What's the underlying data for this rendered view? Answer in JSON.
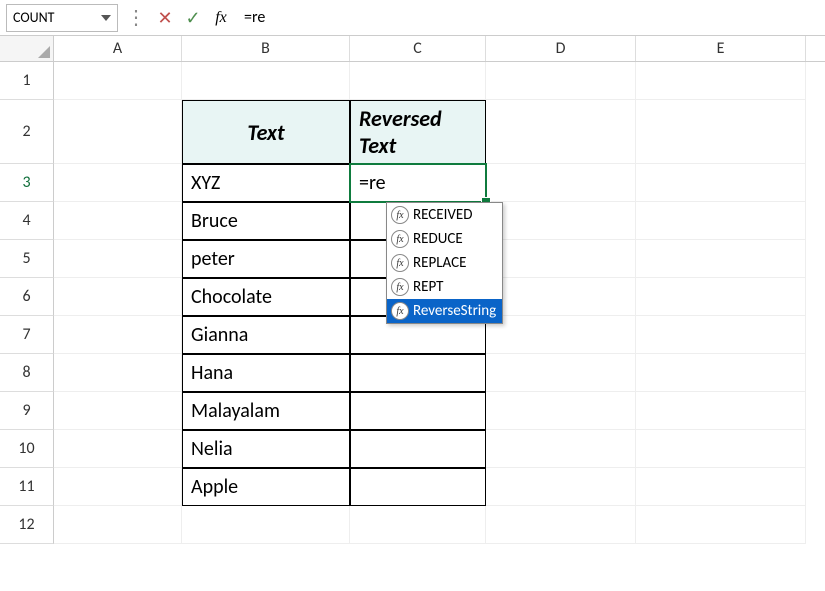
{
  "name_box": "COUNT",
  "formula_bar": "=re",
  "columns": [
    "A",
    "B",
    "C",
    "D",
    "E"
  ],
  "row_numbers": [
    "1",
    "2",
    "3",
    "4",
    "5",
    "6",
    "7",
    "8",
    "9",
    "10",
    "11",
    "12"
  ],
  "headers": {
    "text": "Text",
    "reversed_line1": "Reversed",
    "reversed_line2": "Text"
  },
  "text_values": [
    "XYZ",
    "Bruce",
    "peter",
    "Chocolate",
    "Gianna",
    "Hana",
    "Malayalam",
    "Nelia",
    "Apple"
  ],
  "active_cell_value": "=re",
  "autocomplete": [
    {
      "label": "RECEIVED",
      "selected": false
    },
    {
      "label": "REDUCE",
      "selected": false
    },
    {
      "label": "REPLACE",
      "selected": false
    },
    {
      "label": "REPT",
      "selected": false
    },
    {
      "label": "ReverseString",
      "selected": true
    }
  ],
  "fx_label": "fx"
}
